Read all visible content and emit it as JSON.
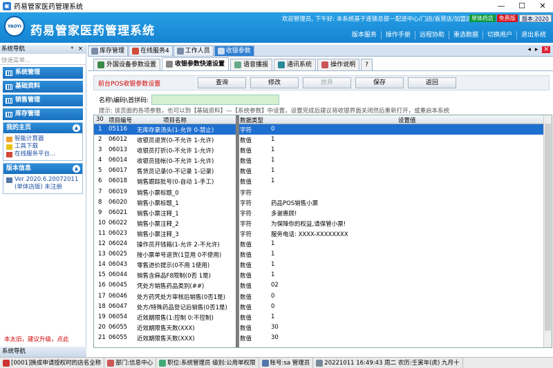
{
  "window": {
    "title": "药易管家医药管理系统",
    "minimize": "—",
    "maximize": "☐",
    "close": "✕"
  },
  "header": {
    "app_title": "药易管家医药管理系统",
    "logo_text": "YAOYI",
    "welcome": "欢迎管理员, 下午好:  本系统基于连锁总部－配送中心/门店/直营店/加盟店、单体",
    "badge_single": "单体药店",
    "badge_free": "免费版",
    "badge_version": "版本:2020",
    "menu": [
      "版本服务",
      "操作手册",
      "远程协助",
      "重选数据",
      "切换用户",
      "退出系统"
    ]
  },
  "sidebar": {
    "title": "系统导航",
    "pin": "ᵠ",
    "close": "×",
    "search_placeholder": "快速菜单...",
    "nav": [
      "系统管理",
      "基础资料",
      "销售管理",
      "库存管理"
    ],
    "home": {
      "title": "我的主页",
      "links": [
        "智能计算器",
        "工具下载",
        "在线服务平台..."
      ]
    },
    "version": {
      "title": "版本信息",
      "text1": "Ver 2020.6.20072011",
      "text2": "(单体店版) 未注册"
    },
    "upgrade": "本太旧，建议升级，点此",
    "bottom_tab": "系统导航"
  },
  "tabs_main": [
    "库存管理",
    "在线服务4",
    "工作人员",
    "收银参数"
  ],
  "tab_ctl": {
    "prev": "◂",
    "next": "▸",
    "close": "✕"
  },
  "tabs_sub": [
    "外国设备参数设置",
    "收银参数快速设置",
    "语音播报",
    "通讯系统",
    "操作说明",
    "?"
  ],
  "toolbar": {
    "title": "前台POS收银参数设置",
    "query": "查询",
    "edit": "修改",
    "discard": "放弃",
    "save": "保存",
    "back": "返回"
  },
  "search": {
    "label": "名称\\编码\\首拼码:",
    "value": ""
  },
  "hint": "提示: 该页面的各项参数，也可以到【基础资料】—【系统参数】中设置，设置完成后建议将收银界面关闭然后重新打开，或重启本系统",
  "table": {
    "count": "30",
    "headers": [
      "项目编号",
      "项目名称",
      "数据类型",
      "设置值"
    ],
    "rows": [
      {
        "no": "1",
        "code": "05116",
        "name": "无库存录汤头(1-允许 0-禁止)",
        "type": "字符",
        "value": "0"
      },
      {
        "no": "2",
        "code": "06012",
        "name": "收银员退货(0-不允许 1-允许)",
        "type": "数值",
        "value": "1"
      },
      {
        "no": "3",
        "code": "06013",
        "name": "收银员打折(0-不允许 1-允许)",
        "type": "数值",
        "value": "1"
      },
      {
        "no": "4",
        "code": "06014",
        "name": "收银员挂帐(0-不允许 1-允许)",
        "type": "数值",
        "value": "1"
      },
      {
        "no": "5",
        "code": "06017",
        "name": "售货员记录(0-不记录 1-记录)",
        "type": "数值",
        "value": "1"
      },
      {
        "no": "6",
        "code": "06018",
        "name": "销售跟踪批号(0-自动 1-手工)",
        "type": "数值",
        "value": "1"
      },
      {
        "no": "7",
        "code": "06019",
        "name": "销售小票标题_0",
        "type": "字符",
        "value": ""
      },
      {
        "no": "8",
        "code": "06020",
        "name": "销售小票标题_1",
        "type": "字符",
        "value": "药品POS销售小票"
      },
      {
        "no": "9",
        "code": "06021",
        "name": "销售小票注释_1",
        "type": "字符",
        "value": "多谢惠顾!"
      },
      {
        "no": "10",
        "code": "06022",
        "name": "销售小票注释_2",
        "type": "字符",
        "value": "为保障你的权益,请保管小票!"
      },
      {
        "no": "11",
        "code": "06023",
        "name": "销售小票注释_3",
        "type": "字符",
        "value": "服务电话: XXXX-XXXXXXXX"
      },
      {
        "no": "12",
        "code": "06024",
        "name": "操作员开钱箱(1-允许 2-不允许)",
        "type": "数值",
        "value": "1"
      },
      {
        "no": "13",
        "code": "06025",
        "name": "按小票单号退货(1豆用 0不使用)",
        "type": "数值",
        "value": "1"
      },
      {
        "no": "14",
        "code": "06043",
        "name": "零售进价提示(0不用 1使用)",
        "type": "数值",
        "value": "1"
      },
      {
        "no": "15",
        "code": "06044",
        "name": "销售含麻品F8限制(0否 1是)",
        "type": "数值",
        "value": "1"
      },
      {
        "no": "16",
        "code": "06045",
        "name": "凭处方销售药品类别(##)",
        "type": "数值",
        "value": "02"
      },
      {
        "no": "17",
        "code": "06046",
        "name": "处方药凭处方审核后销售(0否1是)",
        "type": "数值",
        "value": "0"
      },
      {
        "no": "18",
        "code": "06047",
        "name": "处方/特殊药品登记后销售(0否1是)",
        "type": "数值",
        "value": "0"
      },
      {
        "no": "19",
        "code": "06054",
        "name": "近效期限售(1:控制 0:不控制)",
        "type": "数值",
        "value": "1"
      },
      {
        "no": "20",
        "code": "06055",
        "name": "近效期限售天数(XXX)",
        "type": "数值",
        "value": "30"
      },
      {
        "no": "21",
        "code": "06055",
        "name": "近效期限售天数(XXX)",
        "type": "数值",
        "value": "30"
      }
    ]
  },
  "status": {
    "item1": "[0001]换成申请授权时的店名全称",
    "item2": "部门:信息中心",
    "item3": "职位:系统管理员 级别:公用单权限",
    "item4": "账号:sa 管理员",
    "item5": "20221011 16:49:43 周二 农历:壬寅年(虎) 九月十"
  },
  "colors": {
    "accent": "#1f6fd1",
    "banner": "#1a8ad8",
    "warning": "#d40000"
  }
}
